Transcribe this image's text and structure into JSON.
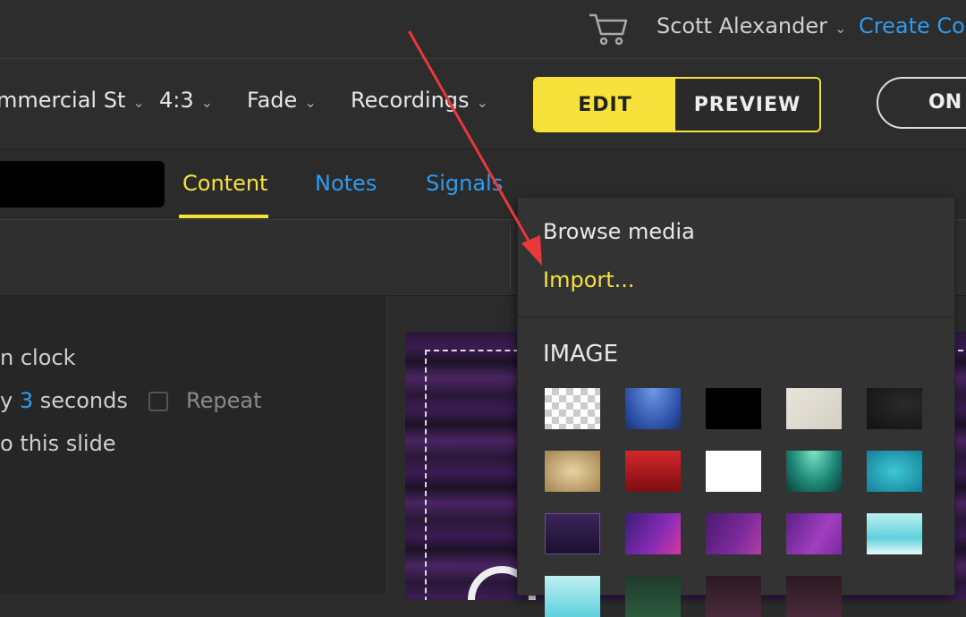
{
  "topbar": {
    "user_name": "Scott Alexander",
    "create_label": "Create Cont"
  },
  "toolbar": {
    "venue": "mmercial St",
    "aspect": "4:3",
    "transition": "Fade",
    "recordings": "Recordings",
    "edit_label": "EDIT",
    "preview_label": "PREVIEW",
    "on_label": "ON"
  },
  "tabs": [
    {
      "label": "Content",
      "active": true
    },
    {
      "label": "Notes",
      "active": false
    },
    {
      "label": "Signals",
      "active": false
    }
  ],
  "left_panel": {
    "clock_text": "n clock",
    "every_prefix": "y",
    "every_value": "3",
    "every_suffix": "seconds",
    "repeat_label": "Repeat",
    "slide_text": "o this slide"
  },
  "dropdown": {
    "browse_label": "Browse media",
    "import_label": "Import...",
    "section_heading": "IMAGE"
  },
  "colors": {
    "accent_yellow": "#f6e23a",
    "link_blue": "#2e9bf0",
    "annotation_red": "#e8393a"
  }
}
